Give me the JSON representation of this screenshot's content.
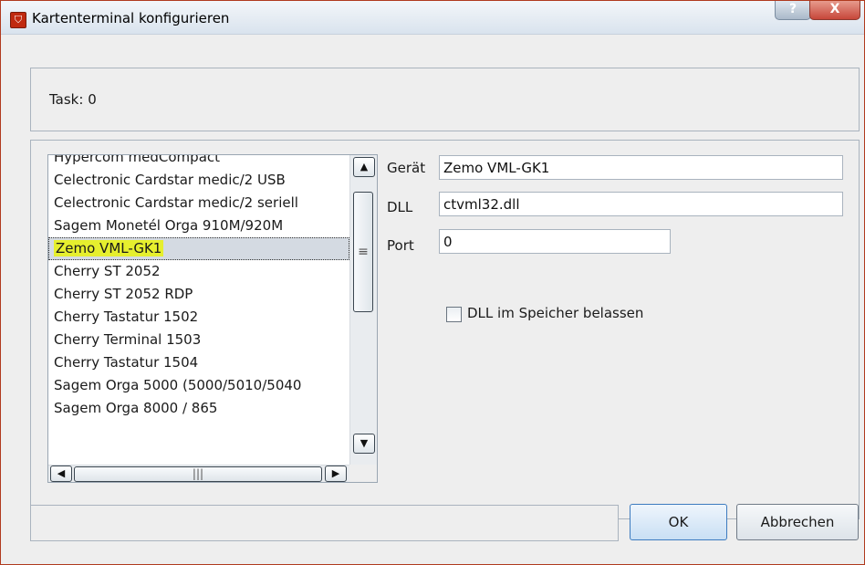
{
  "window": {
    "title": "Kartenterminal konfigurieren",
    "help_label": "?",
    "close_label": "X"
  },
  "task": {
    "label": "Task:",
    "value": "0"
  },
  "device_list": {
    "items": [
      "Hypercom medCompact",
      "Celectronic Cardstar medic/2 USB",
      "Celectronic Cardstar medic/2 seriell",
      "Sagem Monetél Orga 910M/920M",
      "Zemo VML-GK1",
      "Cherry ST 2052",
      "Cherry ST 2052 RDP",
      "Cherry Tastatur 1502",
      "Cherry Terminal 1503",
      "Cherry Tastatur 1504",
      "Sagem Orga 5000 (5000/5010/5040",
      "Sagem Orga 8000 / 865"
    ],
    "selected": "Zemo VML-GK1"
  },
  "form": {
    "device_label": "Gerät",
    "device_value": "Zemo VML-GK1",
    "dll_label": "DLL",
    "dll_value": "ctvml32.dll",
    "port_label": "Port",
    "port_value": "0",
    "keep_dll_label": "DLL im Speicher belassen",
    "keep_dll_checked": false
  },
  "buttons": {
    "ok": "OK",
    "cancel": "Abbrechen"
  }
}
